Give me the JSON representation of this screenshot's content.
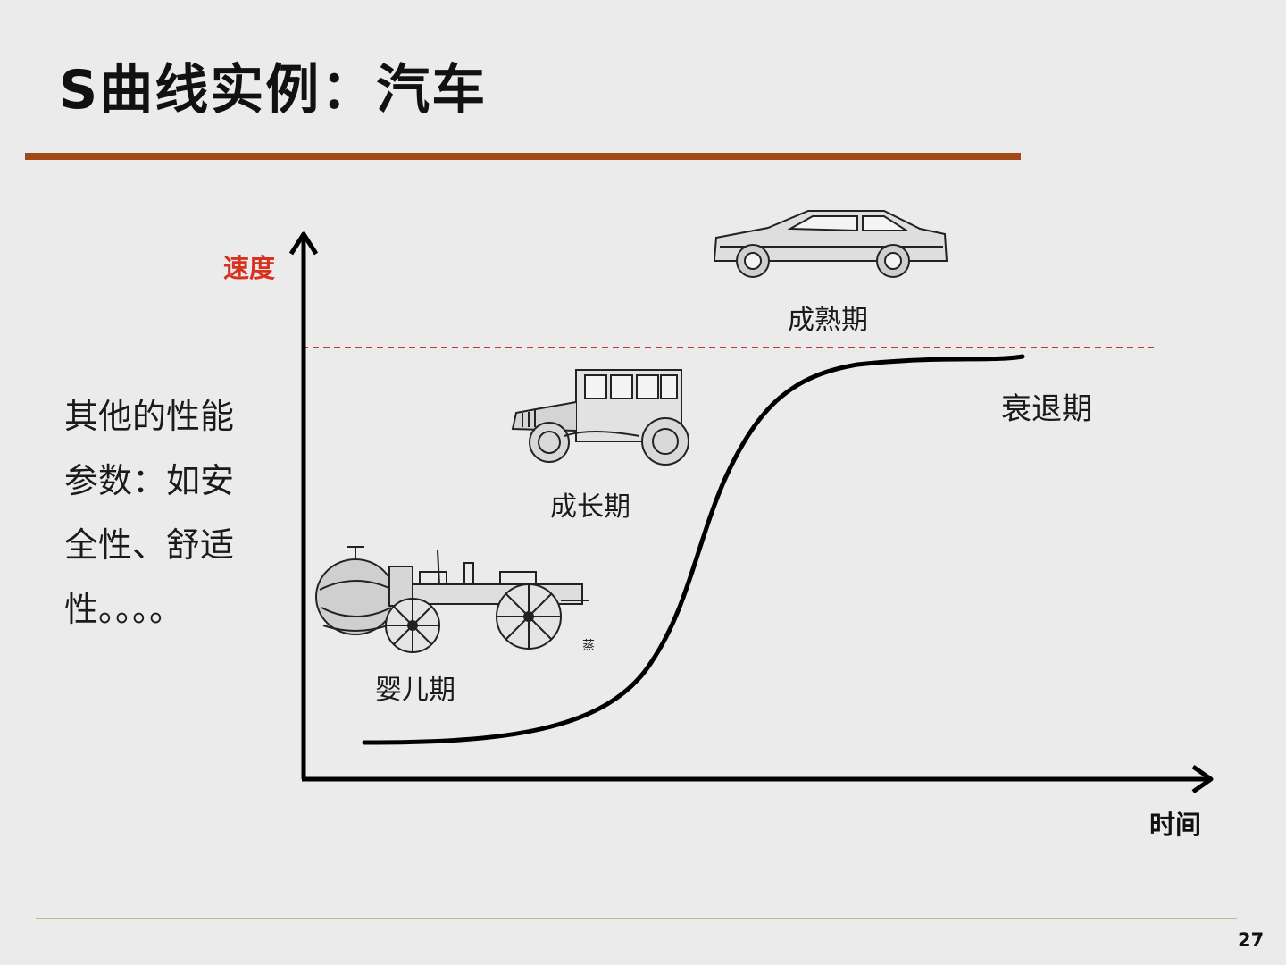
{
  "slide": {
    "title": "S曲线实例：汽车",
    "page_number": "27"
  },
  "side_text": {
    "lines": [
      "其他的性能",
      "参数：如安",
      "全性、舒适",
      "性。。。。"
    ]
  },
  "diagram": {
    "y_axis_label": "速度",
    "x_axis_label": "时间",
    "stages": {
      "infancy": "婴儿期",
      "growth": "成长期",
      "maturity": "成熟期",
      "decline": "衰退期"
    },
    "small_mark": "蒸",
    "colors": {
      "title_rule": "#a04a16",
      "y_axis_label": "#d8321e",
      "limit_line": "#c0392b",
      "curve": "#000000"
    },
    "vehicle_icons": [
      "steam-carriage-icon",
      "vintage-car-icon",
      "modern-sedan-icon"
    ]
  }
}
